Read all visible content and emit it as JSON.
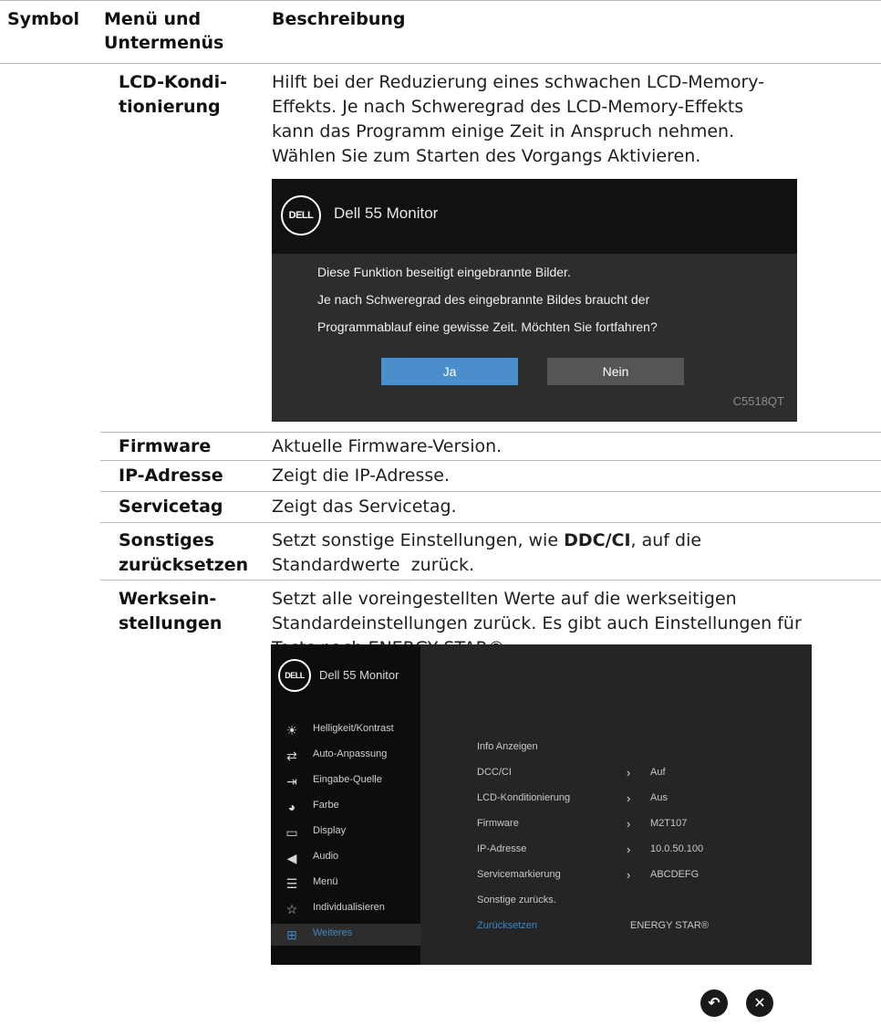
{
  "table_header": {
    "symbol": "Symbol",
    "menu_line1": "Menü und",
    "menu_line2": "Untermenüs",
    "description": "Beschreibung"
  },
  "rows": {
    "lcd": {
      "name_line1": "LCD-Kondi-",
      "name_line2": "tionierung",
      "desc_lines": [
        "Hilft bei der Reduzierung eines schwachen LCD-Memory-",
        "Effekts. Je nach Schweregrad des LCD-Memory-Effekts",
        "kann das Programm einige Zeit in Anspruch nehmen.",
        "Wählen Sie zum Starten des Vorgangs Aktivieren."
      ]
    },
    "firmware": {
      "name": "Firmware",
      "desc": "Aktuelle Firmware-Version."
    },
    "ip": {
      "name": "IP-Adresse",
      "desc": "Zeigt die IP-Adresse."
    },
    "service": {
      "name": "Servicetag",
      "desc": "Zeigt das Servicetag."
    },
    "other_reset": {
      "name_line1": "Sonstiges",
      "name_line2": "zurücksetzen",
      "desc_pre": "Setzt sonstige Einstellungen, wie ",
      "desc_bold": "DDC/CI",
      "desc_post": ", auf die",
      "desc_line2": "Standardwerte  zurück."
    },
    "factory": {
      "name_line1": "Werksein-",
      "name_line2": "stellungen",
      "desc_lines": [
        "Setzt alle voreingestellten Werte auf die werkseitigen",
        "Standardeinstellungen zurück. Es gibt auch Einstellungen für",
        "Tests nach ENERGY STAR®."
      ]
    }
  },
  "dialog": {
    "logo": "DELL",
    "title": "Dell 55 Monitor",
    "lines": [
      "Diese Funktion beseitigt eingebrannte Bilder.",
      "Je nach Schweregrad des eingebrannte Bildes braucht der",
      "Programmablauf eine gewisse Zeit. Möchten Sie fortfahren?"
    ],
    "yes_label": "Ja",
    "no_label": "Nein",
    "model": "C5518QT",
    "colors": {
      "yes_bg": "#4a8fcc",
      "no_bg": "#555555"
    }
  },
  "osd": {
    "logo": "DELL",
    "title": "Dell 55 Monitor",
    "sidebar": [
      {
        "label": "Helligkeit/Kontrast",
        "icon": "brightness-icon"
      },
      {
        "label": "Auto-Anpassung",
        "icon": "auto-adjust-icon"
      },
      {
        "label": "Eingabe-Quelle",
        "icon": "input-source-icon"
      },
      {
        "label": "Farbe",
        "icon": "palette-icon"
      },
      {
        "label": "Display",
        "icon": "display-icon"
      },
      {
        "label": "Audio",
        "icon": "speaker-icon"
      },
      {
        "label": "Menü",
        "icon": "menu-icon"
      },
      {
        "label": "Individualisieren",
        "icon": "star-icon"
      },
      {
        "label": "Weiteres",
        "icon": "others-icon",
        "selected": true
      }
    ],
    "rows": [
      {
        "name": "Info Anzeigen",
        "value": ""
      },
      {
        "name": "DCC/CI",
        "value": "Auf"
      },
      {
        "name": "LCD-Konditionierung",
        "value": "Aus"
      },
      {
        "name": "Firmware",
        "value": "M2T107"
      },
      {
        "name": "IP-Adresse",
        "value": "10.0.50.100"
      },
      {
        "name": "Servicemarkierung",
        "value": "ABCDEFG"
      },
      {
        "name": "Sonstige zurücks.",
        "value": ""
      },
      {
        "name": "Zurücksetzen",
        "value": "ENERGY STAR®",
        "active": true
      }
    ],
    "accent": "#3c87c6",
    "back_icon": "back-icon",
    "close_icon": "close-icon"
  }
}
